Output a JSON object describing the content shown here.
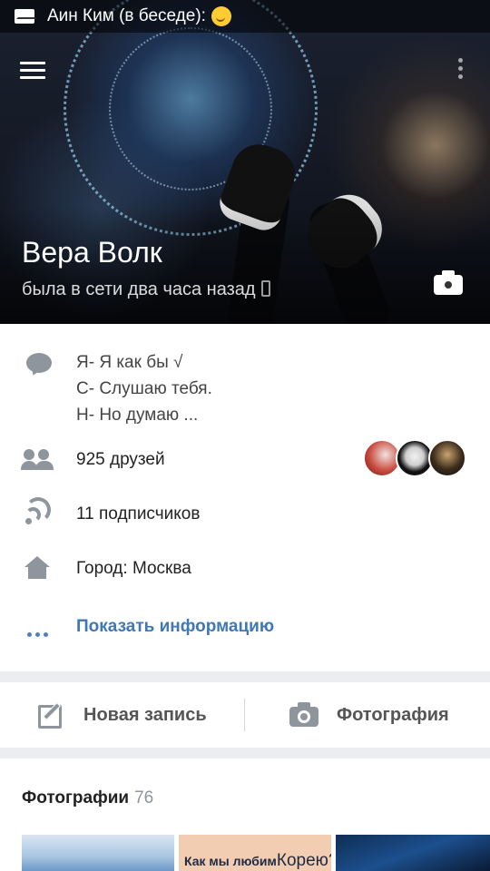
{
  "status_bar": {
    "notification_text": "Аин Ким (в беседе):"
  },
  "profile": {
    "name": "Вера Волк",
    "last_seen": "была в сети два часа назад"
  },
  "info": {
    "status_lines": [
      "Я- Я как бы √",
      "С- Слушаю тебя.",
      "Н- Но думаю ..."
    ],
    "friends": "925 друзей",
    "followers": "11 подписчиков",
    "city": "Город: Москва",
    "show_info": "Показать информацию"
  },
  "actions": {
    "new_post": "Новая запись",
    "photo": "Фотография"
  },
  "photos": {
    "title": "Фотографии",
    "count": "76",
    "thumb2_text_a": "Как мы любим",
    "thumb2_text_b": "Корею?"
  },
  "icons": {
    "status": "chat-bubble-icon",
    "friends": "friends-icon",
    "followers": "rss-icon",
    "city": "home-icon",
    "more": "more-dots-icon",
    "new_post": "edit-icon",
    "photo": "camera-icon"
  },
  "colors": {
    "accent": "#3f78b4",
    "icon_gray": "#8e959d",
    "page_bg": "#ebedf0"
  }
}
